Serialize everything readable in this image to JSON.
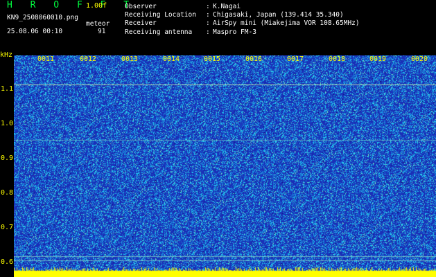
{
  "header": {
    "app_title": "H R O F F T",
    "version": "1.00f",
    "file_name": "KN9_2508060010.png",
    "timestamp": "25.08.06 00:10",
    "meteor_label": "meteor",
    "meteor_count": "91"
  },
  "info": {
    "keys": [
      "Observer",
      "Receiving Location",
      "Receiver",
      "Receiving antenna"
    ],
    "colon": ":",
    "values": [
      "K.Nagai",
      "Chigasaki, Japan (139.414 35.340)",
      "AirSpy mini (Miakejima VOR 108.65MHz)",
      "Maspro FM-3"
    ]
  },
  "spectrogram": {
    "y_unit": "kHz",
    "y_ticks": [
      "1.1",
      "1.0",
      "0.9",
      "0.8",
      "0.7",
      "0.6"
    ],
    "x_ticks": [
      "0011",
      "0012",
      "0013",
      "0014",
      "0015",
      "0016",
      "0017",
      "0018",
      "0019",
      "0020"
    ],
    "colors": {
      "background": "#1a2fb8",
      "noise_cyan": "#20c8f0",
      "noise_light": "#70e0c0",
      "axis_text": "#ffff00",
      "title_green": "#00ff40"
    }
  }
}
